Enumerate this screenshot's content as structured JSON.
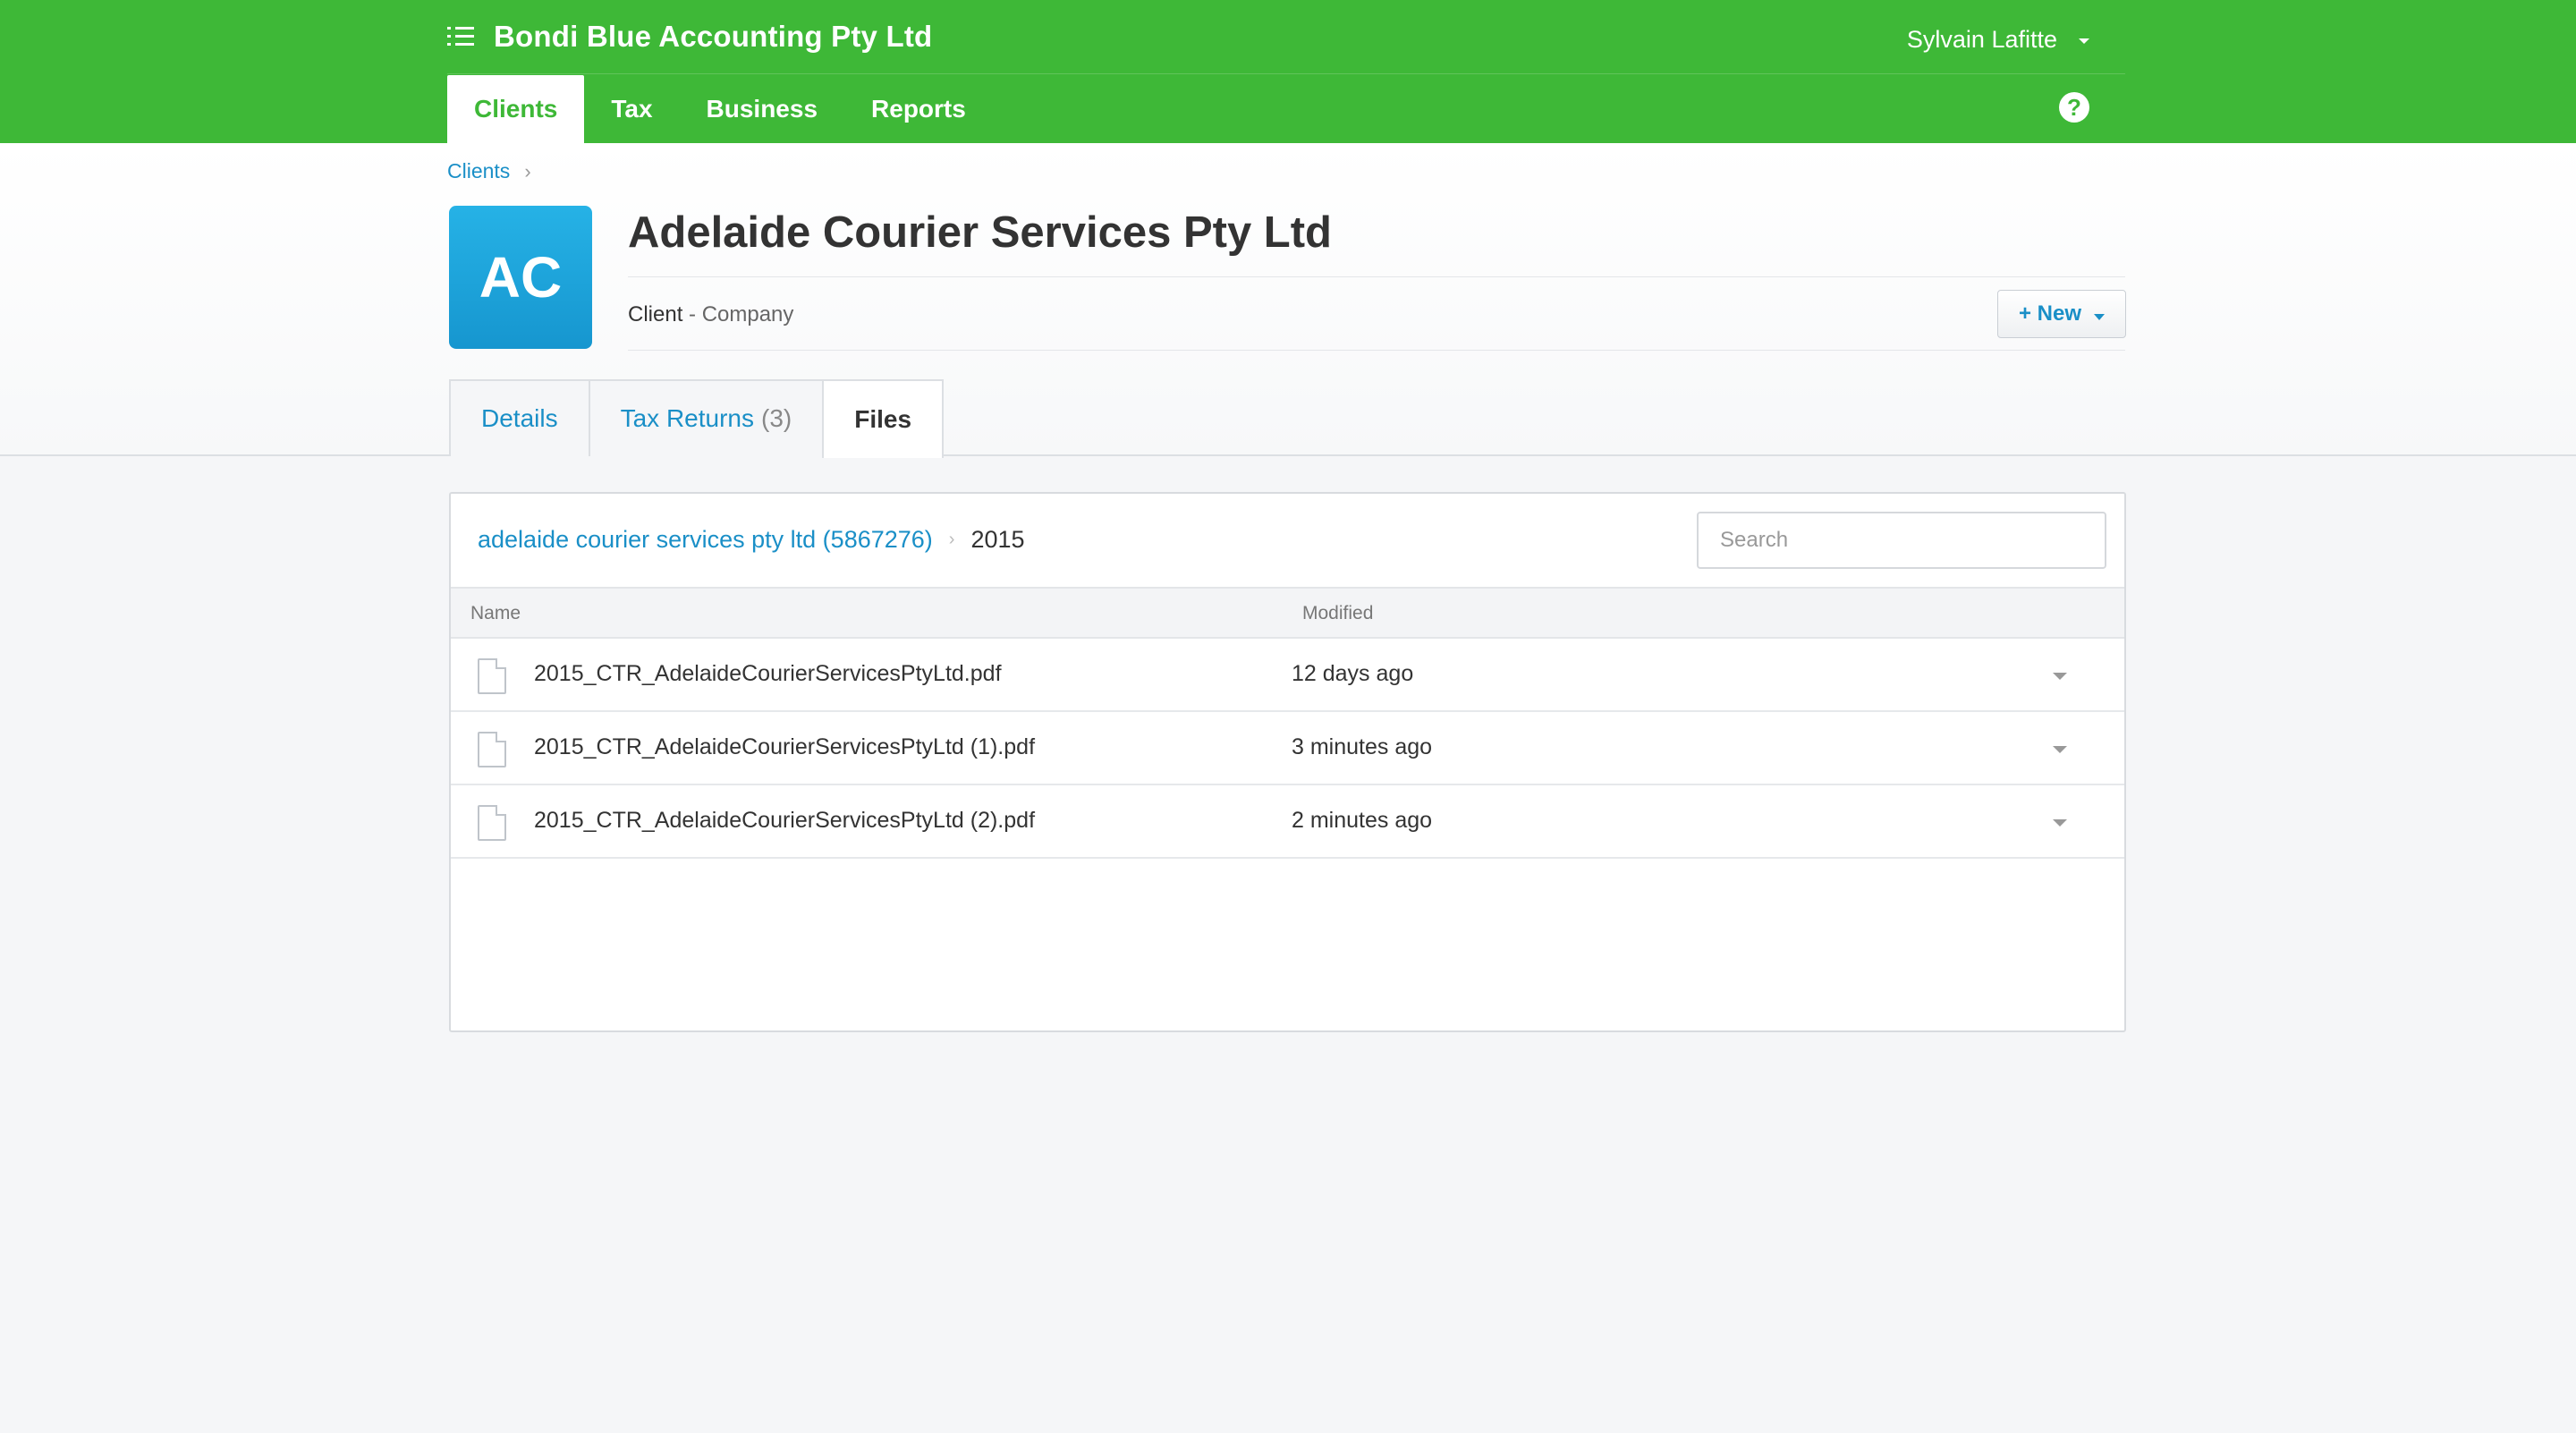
{
  "topbar": {
    "org_name": "Bondi Blue Accounting Pty Ltd",
    "org_icon": "list-icon",
    "user_name": "Sylvain Lafitte",
    "help_label": "?",
    "nav": [
      "Clients",
      "Tax",
      "Business",
      "Reports"
    ],
    "active_nav": "Clients",
    "color": "#3eb837"
  },
  "breadcrumb": {
    "items": [
      "Clients"
    ],
    "separator": "›"
  },
  "client": {
    "initials": "AC",
    "name": "Adelaide Courier Services Pty Ltd",
    "role": "Client",
    "type": " - Company",
    "new_button": "+ New"
  },
  "tabs": [
    {
      "label": "Details",
      "count": ""
    },
    {
      "label": "Tax Returns",
      "count": "(3)"
    },
    {
      "label": "Files",
      "count": ""
    }
  ],
  "active_tab": "Files",
  "files": {
    "path": {
      "root": "adelaide courier services pty ltd (5867276)",
      "separator": "›",
      "current": "2015"
    },
    "search_placeholder": "Search",
    "columns": [
      "Name",
      "Modified"
    ],
    "rows": [
      {
        "name": "2015_CTR_AdelaideCourierServicesPtyLtd.pdf",
        "modified": "12 days ago"
      },
      {
        "name": "2015_CTR_AdelaideCourierServicesPtyLtd (1).pdf",
        "modified": "3 minutes ago"
      },
      {
        "name": "2015_CTR_AdelaideCourierServicesPtyLtd (2).pdf",
        "modified": "2 minutes ago"
      }
    ]
  },
  "colors": {
    "brand_green": "#3eb837",
    "link_blue": "#1a8fc7",
    "avatar_blue": "#1ea5dd"
  }
}
